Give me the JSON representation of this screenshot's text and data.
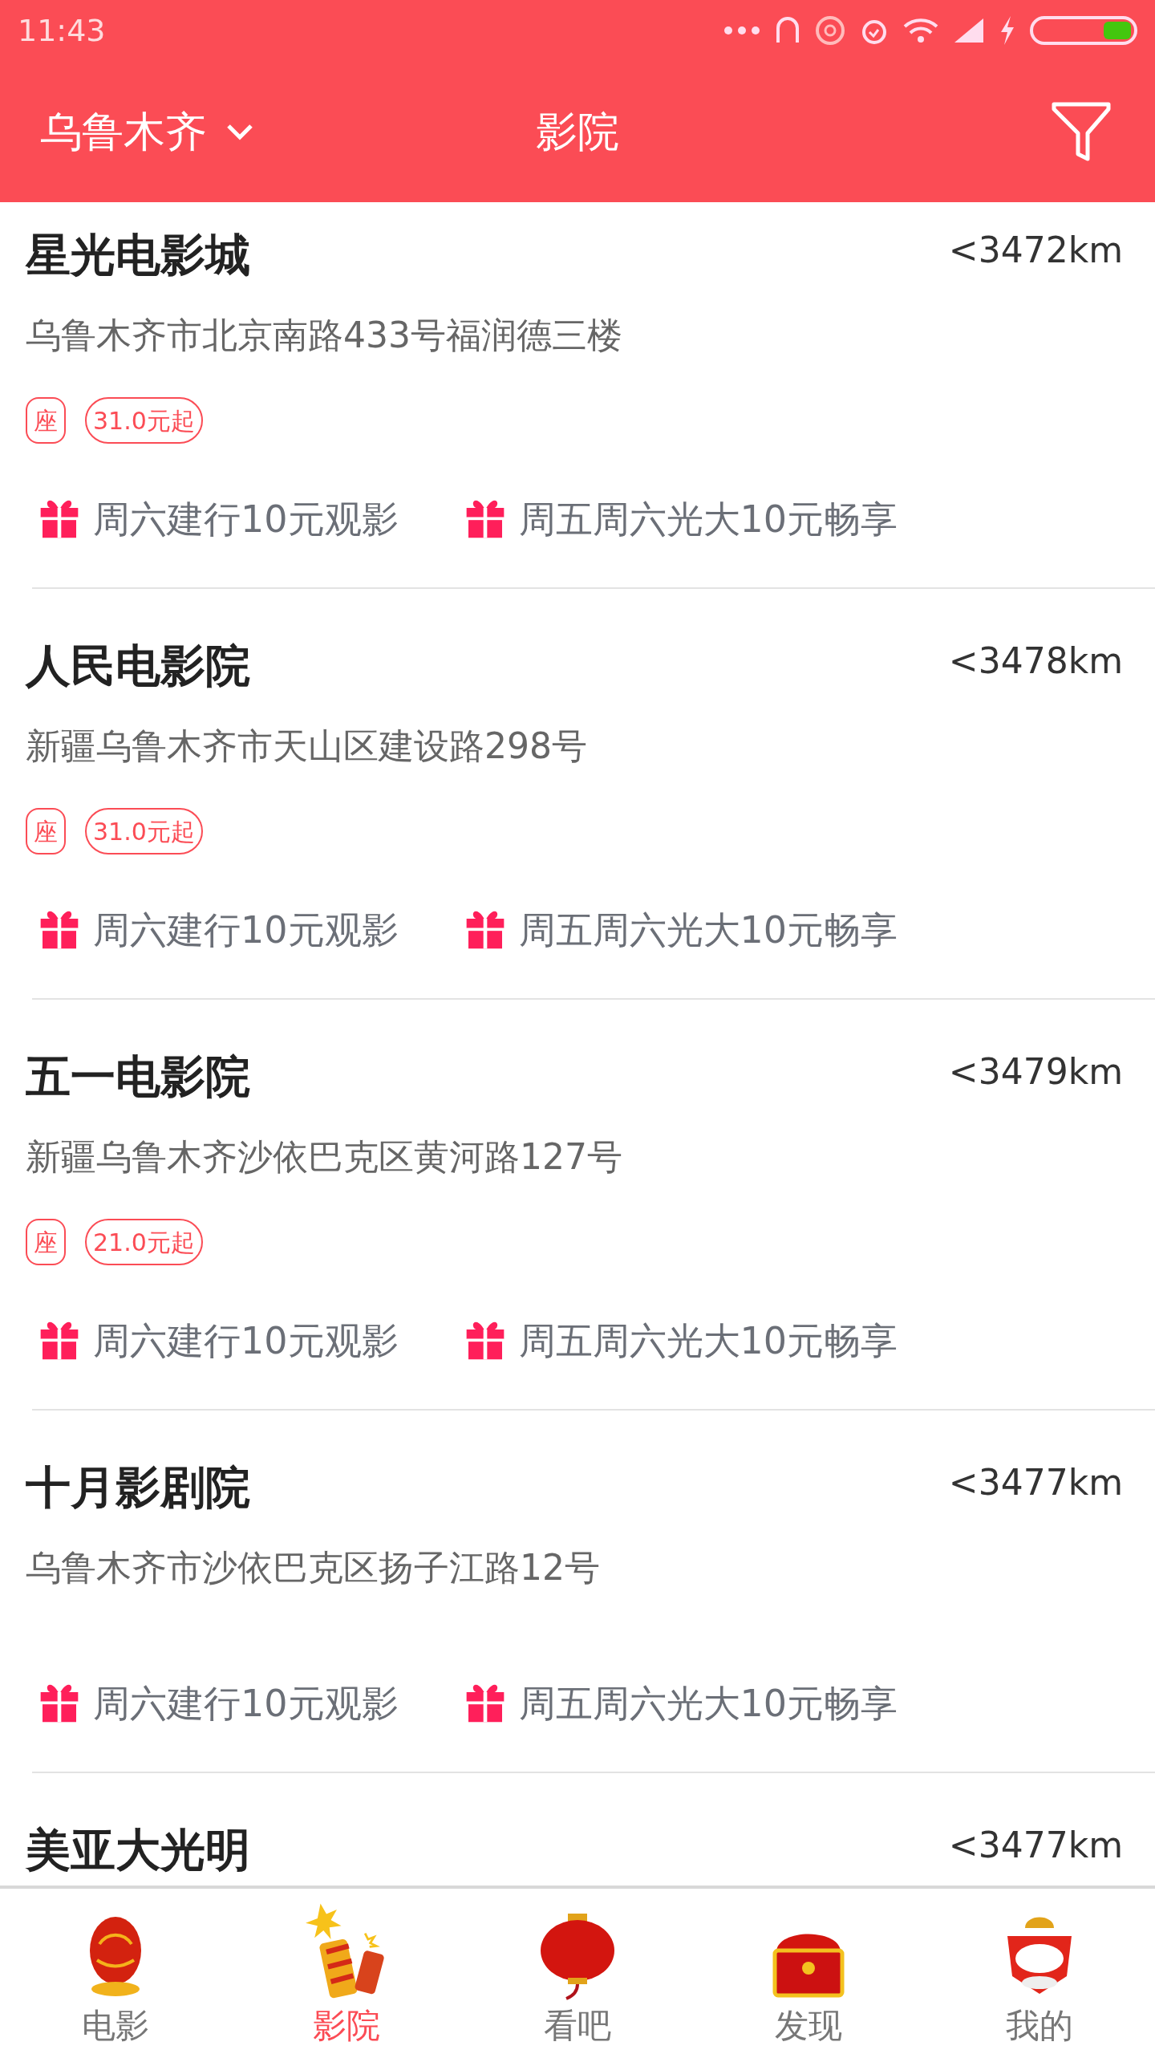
{
  "status_bar": {
    "time": "11:43"
  },
  "header": {
    "city": "乌鲁木齐",
    "title": "影院"
  },
  "cinemas": [
    {
      "name": "星光电影城",
      "distance": "<3472km",
      "address": "乌鲁木齐市北京南路433号福润德三楼",
      "tags": [
        "座",
        "31.0元起"
      ],
      "offers": [
        "周六建行10元观影",
        "周五周六光大10元畅享"
      ]
    },
    {
      "name": "人民电影院",
      "distance": "<3478km",
      "address": "新疆乌鲁木齐市天山区建设路298号",
      "tags": [
        "座",
        "31.0元起"
      ],
      "offers": [
        "周六建行10元观影",
        "周五周六光大10元畅享"
      ]
    },
    {
      "name": "五一电影院",
      "distance": "<3479km",
      "address": "新疆乌鲁木齐沙依巴克区黄河路127号",
      "tags": [
        "座",
        "21.0元起"
      ],
      "offers": [
        "周六建行10元观影",
        "周五周六光大10元畅享"
      ]
    },
    {
      "name": "十月影剧院",
      "distance": "<3477km",
      "address": "乌鲁木齐市沙依巴克区扬子江路12号",
      "offers": [
        "周六建行10元观影",
        "周五周六光大10元畅享"
      ]
    },
    {
      "name": "美亚大光明",
      "distance": "<3477km"
    }
  ],
  "tab_bar": [
    {
      "label": "电影",
      "kind": "egg",
      "selected": false
    },
    {
      "label": "影院",
      "kind": "firecracker",
      "selected": true
    },
    {
      "label": "看吧",
      "kind": "lantern",
      "selected": false
    },
    {
      "label": "发现",
      "kind": "chest",
      "selected": false
    },
    {
      "label": "我的",
      "kind": "lion",
      "selected": false
    }
  ]
}
